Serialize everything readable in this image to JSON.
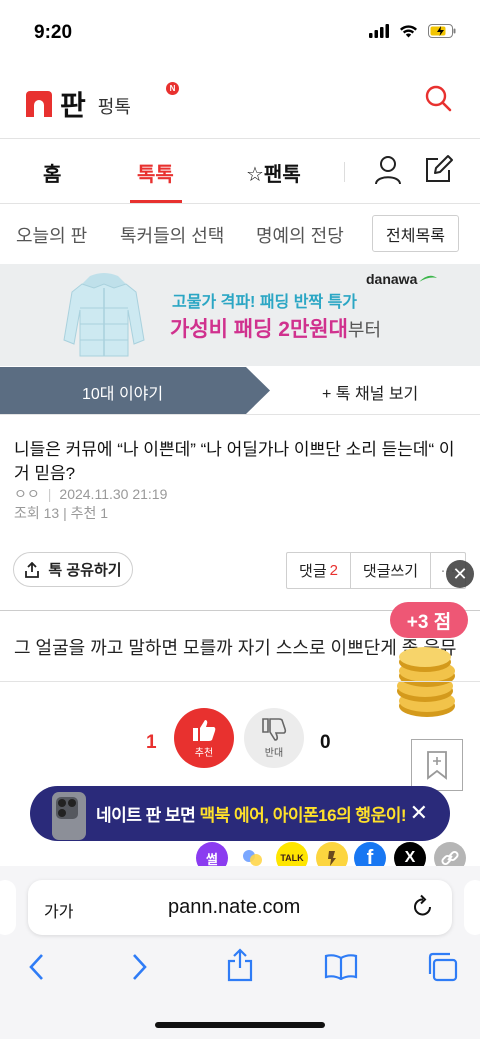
{
  "status": {
    "time": "9:20"
  },
  "header": {
    "logo_text": "판",
    "logo_sub": "펑톡",
    "badge": "N"
  },
  "main_tabs": [
    {
      "label": "홈"
    },
    {
      "label": "톡톡"
    },
    {
      "label": "☆팬톡"
    }
  ],
  "sub_tabs": [
    {
      "label": "오늘의 판"
    },
    {
      "label": "톡커들의 선택"
    },
    {
      "label": "명예의 전당"
    }
  ],
  "all_list_label": "전체목록",
  "ad": {
    "line1": "고물가 격파! 패딩 반짝 특가",
    "line2": "가성비 패딩 2만원대",
    "line2_suffix": "부터",
    "brand": "danawa"
  },
  "channel": {
    "current": "10대 이야기",
    "more": "+ 톡 채널 보기"
  },
  "post": {
    "title": "니들은 커뮤에 “나 이쁜데” “나 어딜가나 이쁘단 소리 듣는데“ 이거 믿음?",
    "author": "ㅇㅇ",
    "date": "2024.11.30 21:19",
    "stats": "조회 13 | 추천 1",
    "share_label": "톡 공유하기",
    "comment_label": "댓글",
    "comment_count": "2",
    "write_comment_label": "댓글쓰기",
    "more_label": "···",
    "body": "그 얼굴을 까고 말하면 모를까 자기 스스로 이쁘단게 좀 웃뮤"
  },
  "points_popup": "+3 점",
  "votes": {
    "up_count": "1",
    "up_label": "추천",
    "down_count": "0",
    "down_label": "반대"
  },
  "promo": {
    "text_prefix": "네이트 판 보면 ",
    "text_highlight": "맥북 에어, 아이폰16의 행운이!"
  },
  "social": [
    "썰",
    "TALK",
    "f",
    "X"
  ],
  "browser": {
    "text_size": "가가",
    "url": "pann.nate.com"
  },
  "colors": {
    "accent": "#e8312f",
    "channel_bar": "#5b6d82",
    "promo_bg": "#2a2a7a"
  }
}
